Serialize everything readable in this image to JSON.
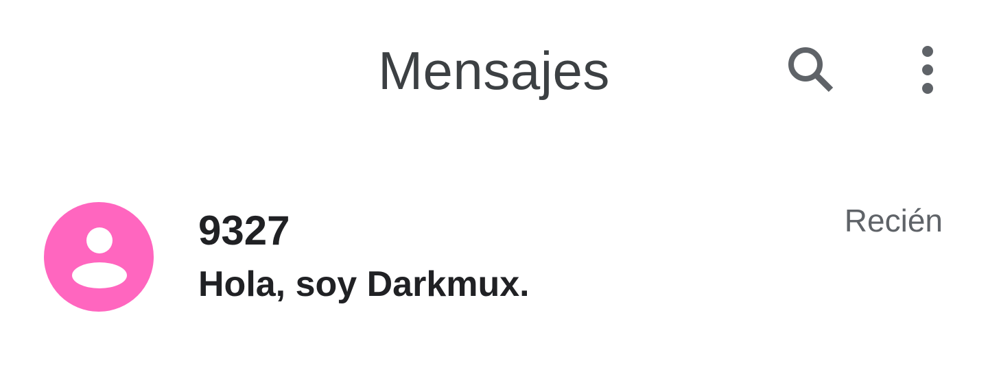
{
  "app_bar": {
    "title": "Mensajes",
    "icons": {
      "search": "search-icon",
      "more": "more-vert-icon"
    }
  },
  "conversations": [
    {
      "sender": "9327",
      "snippet": "Hola, soy Darkmux.",
      "timestamp": "Recién",
      "avatar_icon": "person-icon",
      "avatar_color": "#ff66bf",
      "unread": true
    }
  ],
  "colors": {
    "title": "#3c4043",
    "icon": "#5f6368",
    "primary_text": "#202124",
    "secondary_text": "#5f6368",
    "background": "#ffffff"
  }
}
